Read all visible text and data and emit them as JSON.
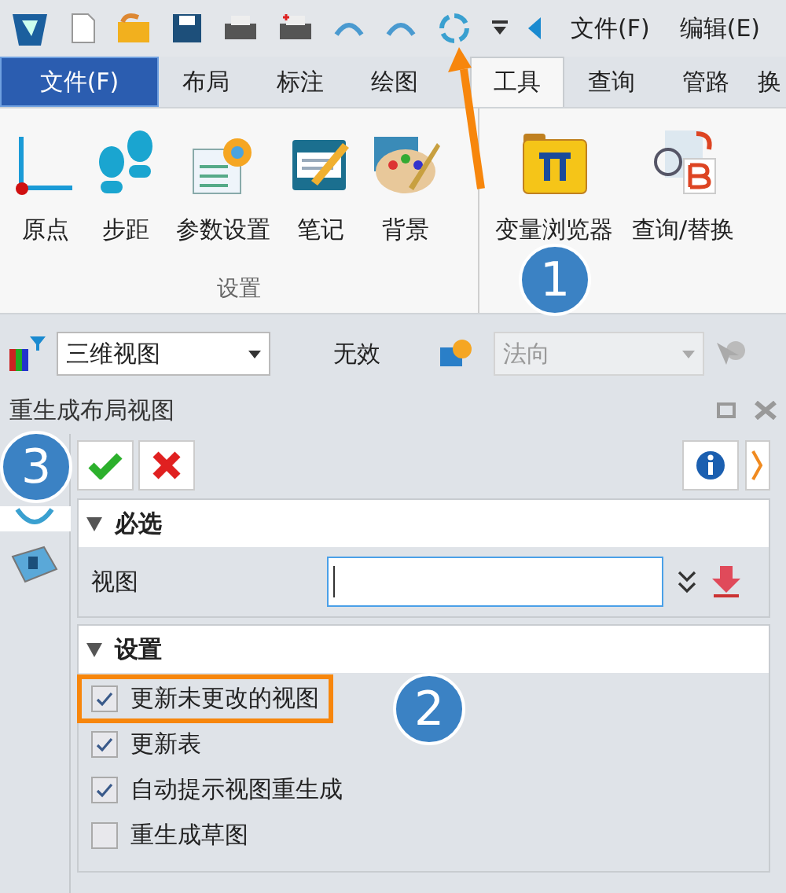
{
  "quick_access": {
    "menus": [
      {
        "label": "文件(F)"
      },
      {
        "label": "编辑(E)"
      }
    ]
  },
  "ribbon_tabs": [
    {
      "label": "文件(F)",
      "kind": "file",
      "selected": false
    },
    {
      "label": "布局",
      "kind": "tab",
      "selected": false
    },
    {
      "label": "标注",
      "kind": "tab",
      "selected": false
    },
    {
      "label": "绘图",
      "kind": "tab",
      "selected": false
    },
    {
      "label": "工具",
      "kind": "tab",
      "selected": true
    },
    {
      "label": "查询",
      "kind": "tab",
      "selected": false
    },
    {
      "label": "管路",
      "kind": "tab",
      "selected": false
    },
    {
      "label": "换",
      "kind": "tab",
      "selected": false
    }
  ],
  "ribbon": {
    "groups": [
      {
        "label": "设置",
        "buttons": [
          {
            "label": "原点"
          },
          {
            "label": "步距"
          },
          {
            "label": "参数设置"
          },
          {
            "label": "笔记"
          },
          {
            "label": "背景"
          }
        ]
      },
      {
        "buttons": [
          {
            "label": "变量浏览器"
          },
          {
            "label": "查询/替换"
          }
        ]
      }
    ]
  },
  "toolbar": {
    "view_combo": "三维视图",
    "status": "无效",
    "direction_combo": {
      "value": "法向",
      "disabled": true
    }
  },
  "panel": {
    "title": "重生成布局视图",
    "sections": [
      {
        "title": "必选",
        "expanded": true,
        "field": {
          "label": "视图"
        }
      },
      {
        "title": "设置",
        "expanded": true,
        "options": [
          {
            "label": "更新未更改的视图",
            "checked": true,
            "highlighted": true
          },
          {
            "label": "更新表",
            "checked": true,
            "highlighted": false
          },
          {
            "label": "自动提示视图重生成",
            "checked": true,
            "highlighted": false
          },
          {
            "label": "重生成草图",
            "checked": false,
            "highlighted": false
          }
        ]
      }
    ]
  },
  "annotations": [
    {
      "label": "1"
    },
    {
      "label": "2"
    },
    {
      "label": "3"
    }
  ]
}
